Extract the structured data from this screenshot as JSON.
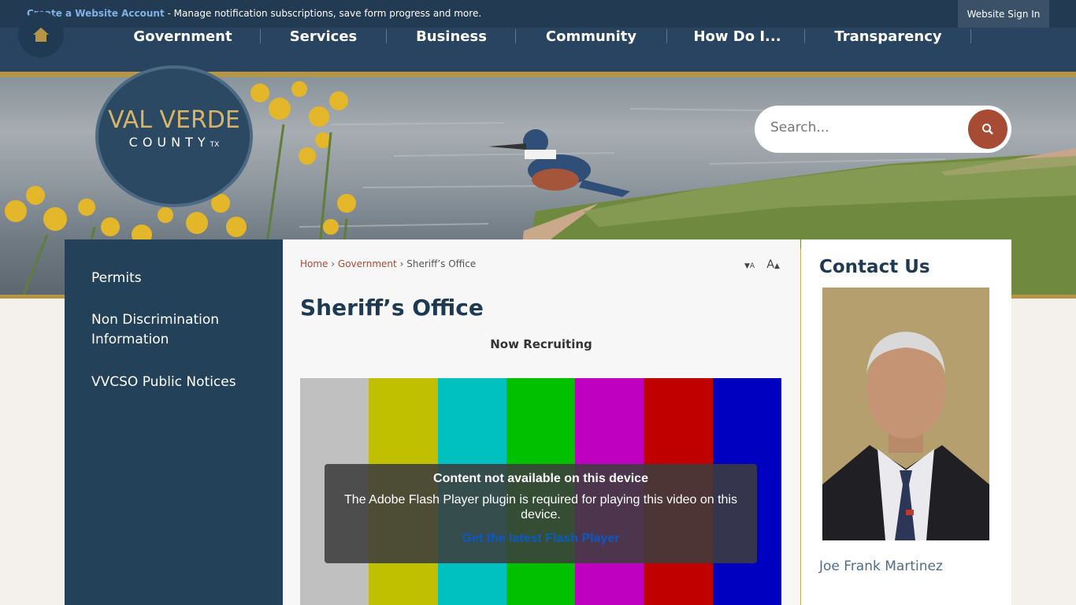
{
  "notification": {
    "link_text": "Create a Website Account",
    "text": " - Manage notification subscriptions, save form progress and more.",
    "sign_in": "Website Sign In"
  },
  "nav": {
    "items": [
      {
        "label": "Government"
      },
      {
        "label": "Services"
      },
      {
        "label": "Business"
      },
      {
        "label": "Community"
      },
      {
        "label": "How Do I..."
      },
      {
        "label": "Transparency"
      }
    ]
  },
  "logo": {
    "line1": "VAL VERDE",
    "line2": "COUNTY",
    "suffix": "TX"
  },
  "search": {
    "placeholder": "Search..."
  },
  "sidebar": {
    "items": [
      {
        "label": "Permits"
      },
      {
        "label": "Non Discrimination Information"
      },
      {
        "label": "VVCSO Public Notices"
      }
    ]
  },
  "breadcrumb": {
    "home": "Home",
    "section": "Government",
    "current": "Sheriff’s Office",
    "sep": "›"
  },
  "font_size": {
    "decrease": "A",
    "increase": "A"
  },
  "main": {
    "title": "Sheriff’s Office",
    "subtitle": "Now Recruiting"
  },
  "video": {
    "bar_colors": [
      "#c0c0c0",
      "#c0c000",
      "#00c0c0",
      "#00c000",
      "#c000c0",
      "#c00000",
      "#0000c0"
    ],
    "message_title": "Content not available on this device",
    "message_body": "The Adobe Flash Player plugin is required for playing this video on this device.",
    "message_link": "Get the latest Flash Player"
  },
  "contact": {
    "title": "Contact Us",
    "name": "Joe Frank Martinez"
  },
  "colors": {
    "nav_bg": "#284461",
    "accent_gold": "#b69547",
    "search_btn": "#a84b35",
    "title_color": "#1e3a52"
  }
}
